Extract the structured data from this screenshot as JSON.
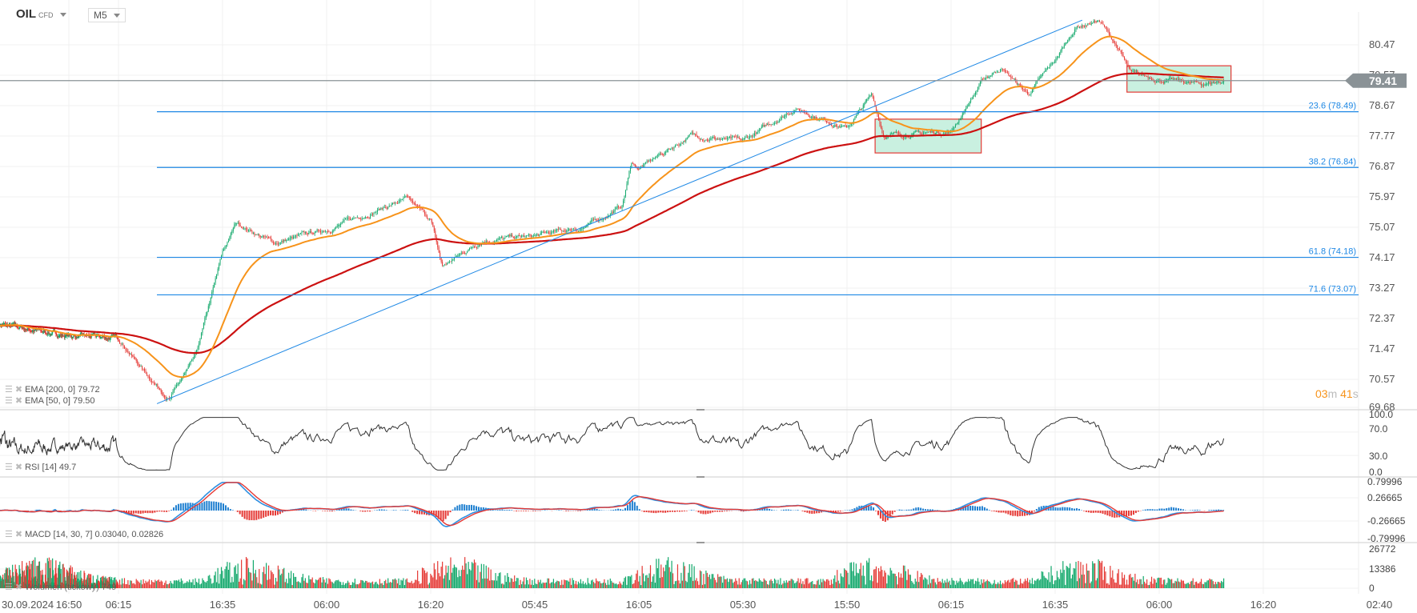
{
  "header": {
    "symbol": "OIL",
    "instrument_type": "CFD",
    "timeframe": "M5"
  },
  "legends": {
    "ema200": "EMA [200, 0] 79.72",
    "ema50": "EMA [50, 0] 79.50",
    "rsi": "RSI [14] 49.7",
    "macd": "MACD [14, 30, 7] 0.03040, 0.02826",
    "volume": "Wolumen (tickowy) 749"
  },
  "timer": {
    "minutes": "03",
    "m": "m",
    "seconds": "41",
    "s": "s"
  },
  "colors": {
    "up": "#12a86b",
    "down": "#e53935",
    "ema50": "#f7931a",
    "ema200": "#cc1111",
    "fib": "#1e88e5",
    "price_tag": "#8a9296",
    "zone_fill": "#c9f0e0",
    "zone_border": "#e53935"
  },
  "chart_data": {
    "type": "candlestick",
    "symbol": "OIL",
    "current_price": 79.41,
    "current_price_label": "79.41",
    "x_ticks": [
      "16:50",
      "06:15",
      "16:35",
      "06:00",
      "16:20",
      "05:45",
      "16:05",
      "05:30",
      "15:50",
      "06:15",
      "16:35",
      "06:00",
      "16:20"
    ],
    "date_label": "30.09.2024",
    "x_axis_end_label": "02:40",
    "price_axis_labels": [
      "80.47",
      "79.57",
      "78.67",
      "77.77",
      "76.87",
      "75.97",
      "75.07",
      "74.17",
      "73.27",
      "72.37",
      "71.47",
      "70.57",
      "69.68"
    ],
    "ylim": [
      69.68,
      80.8
    ],
    "close_path_note_units": "x = position on time axis measured in tick intervals (0 = first tick 16:50)",
    "close_path": [
      [
        -1.43,
        72.2
      ],
      [
        0,
        71.85
      ],
      [
        1,
        71.8
      ],
      [
        1.25,
        70.8
      ],
      [
        1.49,
        70.0
      ],
      [
        1.74,
        71.2
      ],
      [
        2,
        74.3
      ],
      [
        2.13,
        75.2
      ],
      [
        2.5,
        74.6
      ],
      [
        3,
        75.0
      ],
      [
        3.5,
        75.6
      ],
      [
        3.76,
        75.9
      ],
      [
        4,
        75.3
      ],
      [
        4.11,
        73.9
      ],
      [
        4.5,
        74.7
      ],
      [
        5,
        74.8
      ],
      [
        5.5,
        75.1
      ],
      [
        5.84,
        75.7
      ],
      [
        5.93,
        77.0
      ],
      [
        6,
        76.8
      ],
      [
        6.5,
        77.8
      ],
      [
        7,
        77.6
      ],
      [
        7.5,
        78.6
      ],
      [
        8,
        78.0
      ],
      [
        8.24,
        79.0
      ],
      [
        8.35,
        77.8
      ],
      [
        9,
        77.9
      ],
      [
        9.3,
        79.4
      ],
      [
        9.48,
        79.8
      ],
      [
        9.74,
        79.0
      ],
      [
        10,
        80.0
      ],
      [
        10.2,
        81.0
      ],
      [
        10.42,
        81.2
      ],
      [
        10.6,
        80.4
      ],
      [
        10.73,
        79.6
      ],
      [
        11,
        79.45
      ],
      [
        11.4,
        79.3
      ],
      [
        11.62,
        79.41
      ]
    ],
    "fibonacci": [
      {
        "level": "23.6",
        "price": 78.49,
        "label": "23.6 (78.49)"
      },
      {
        "level": "38.2",
        "price": 76.84,
        "label": "38.2 (76.84)"
      },
      {
        "level": "61.8",
        "price": 74.18,
        "label": "61.8 (74.18)"
      },
      {
        "level": "71.6",
        "price": 73.07,
        "label": "71.6 (73.07)"
      }
    ],
    "trendline": {
      "from": [
        1.37,
        69.85
      ],
      "to": [
        10.26,
        81.2
      ]
    },
    "zones": [
      {
        "x": [
          8.27,
          9.29
        ],
        "price": [
          77.27,
          78.27
        ]
      },
      {
        "x": [
          10.69,
          11.69
        ],
        "price": [
          79.07,
          79.85
        ]
      }
    ],
    "indicators": {
      "ema": [
        {
          "period": 200,
          "value": 79.72
        },
        {
          "period": 50,
          "value": 79.5
        }
      ],
      "rsi": {
        "period": 14,
        "value": 49.7,
        "axis_labels": [
          "100.0",
          "70.0",
          "30.0",
          "0.0"
        ]
      },
      "macd": {
        "params": [
          14,
          30,
          7
        ],
        "macd": 0.0304,
        "signal": 0.02826,
        "axis_labels": [
          "0.79996",
          "0.26665",
          "-0.26665",
          "-0.79996"
        ]
      },
      "volume": {
        "last": 749,
        "axis_labels": [
          "26772",
          "13386",
          "0"
        ]
      }
    }
  }
}
